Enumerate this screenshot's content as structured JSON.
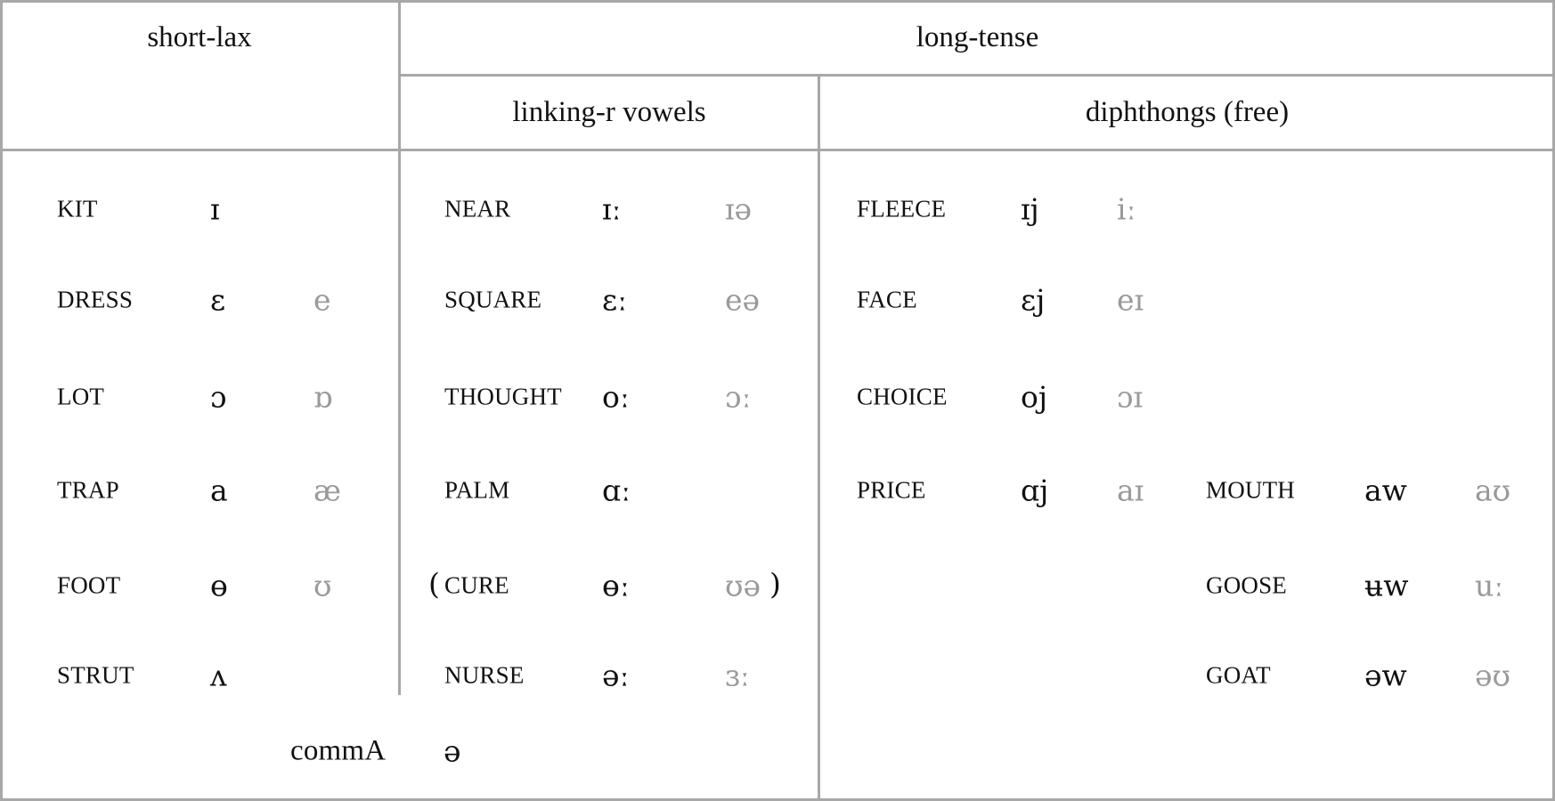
{
  "headers": {
    "short_lax": "short-lax",
    "long_tense": "long-tense",
    "linking_r": "linking-r vowels",
    "diphthongs": "diphthongs (free)"
  },
  "short_lax": [
    {
      "word": "KIT",
      "ipa": "ɪ",
      "alt": ""
    },
    {
      "word": "DRESS",
      "ipa": "ɛ",
      "alt": "e"
    },
    {
      "word": "LOT",
      "ipa": "ɔ",
      "alt": "ɒ"
    },
    {
      "word": "TRAP",
      "ipa": "a",
      "alt": "æ"
    },
    {
      "word": "FOOT",
      "ipa": "ɵ",
      "alt": "ʊ"
    },
    {
      "word": "STRUT",
      "ipa": "ʌ",
      "alt": ""
    }
  ],
  "linking_r": [
    {
      "word": "NEAR",
      "ipa": "ɪː",
      "alt": "ɪə"
    },
    {
      "word": "SQUARE",
      "ipa": "ɛː",
      "alt": "eə"
    },
    {
      "word": "THOUGHT",
      "ipa": "oː",
      "alt": "ɔː"
    },
    {
      "word": "PALM",
      "ipa": "ɑː",
      "alt": ""
    },
    {
      "word": "CURE",
      "ipa": "ɵː",
      "alt": "ʊə",
      "open_paren": "(",
      "close_paren": ")"
    },
    {
      "word": "NURSE",
      "ipa": "əː",
      "alt": "ɜː"
    }
  ],
  "diphthongs_front": [
    {
      "word": "FLEECE",
      "ipa": "ɪj",
      "alt": "iː"
    },
    {
      "word": "FACE",
      "ipa": "ɛj",
      "alt": "eɪ"
    },
    {
      "word": "CHOICE",
      "ipa": "oj",
      "alt": "ɔɪ"
    },
    {
      "word": "PRICE",
      "ipa": "ɑj",
      "alt": "aɪ"
    }
  ],
  "diphthongs_back": [
    {
      "word": "MOUTH",
      "ipa": "aw",
      "alt": "aʊ"
    },
    {
      "word": "GOOSE",
      "ipa": "ʉw",
      "alt": "uː"
    },
    {
      "word": "GOAT",
      "ipa": "əw",
      "alt": "əʊ"
    }
  ],
  "comma": {
    "word": "commA",
    "ipa": "ə"
  },
  "colors": {
    "border": "#a8a8a8",
    "alt_text": "#9a9a9a",
    "text": "#111111"
  }
}
